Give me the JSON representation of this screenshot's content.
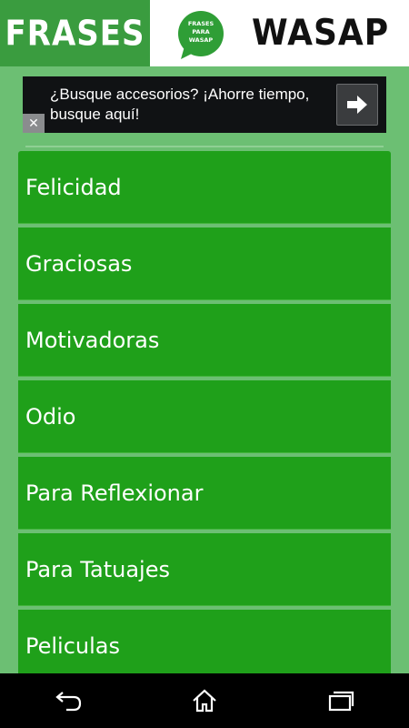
{
  "header": {
    "title_left": "FRASES",
    "logo_lines": [
      "FRASES",
      "PARA",
      "WASAP"
    ],
    "title_right": "WASAP"
  },
  "ad": {
    "text": "¿Busque accesorios? ¡Ahorre tiempo, busque aquí!",
    "close_symbol": "✕"
  },
  "categories": [
    "Felicidad",
    "Graciosas",
    "Motivadoras",
    "Odio",
    "Para Reflexionar",
    "Para Tatuajes",
    "Peliculas"
  ],
  "colors": {
    "background": "#6cbf73",
    "header_left": "#3a9c3f",
    "item": "#1fa01a",
    "logo_bubble": "#2f9e36"
  },
  "icons": {
    "ad_arrow": "arrow-right-icon",
    "nav_back": "back-icon",
    "nav_home": "home-icon",
    "nav_recents": "recents-icon"
  }
}
